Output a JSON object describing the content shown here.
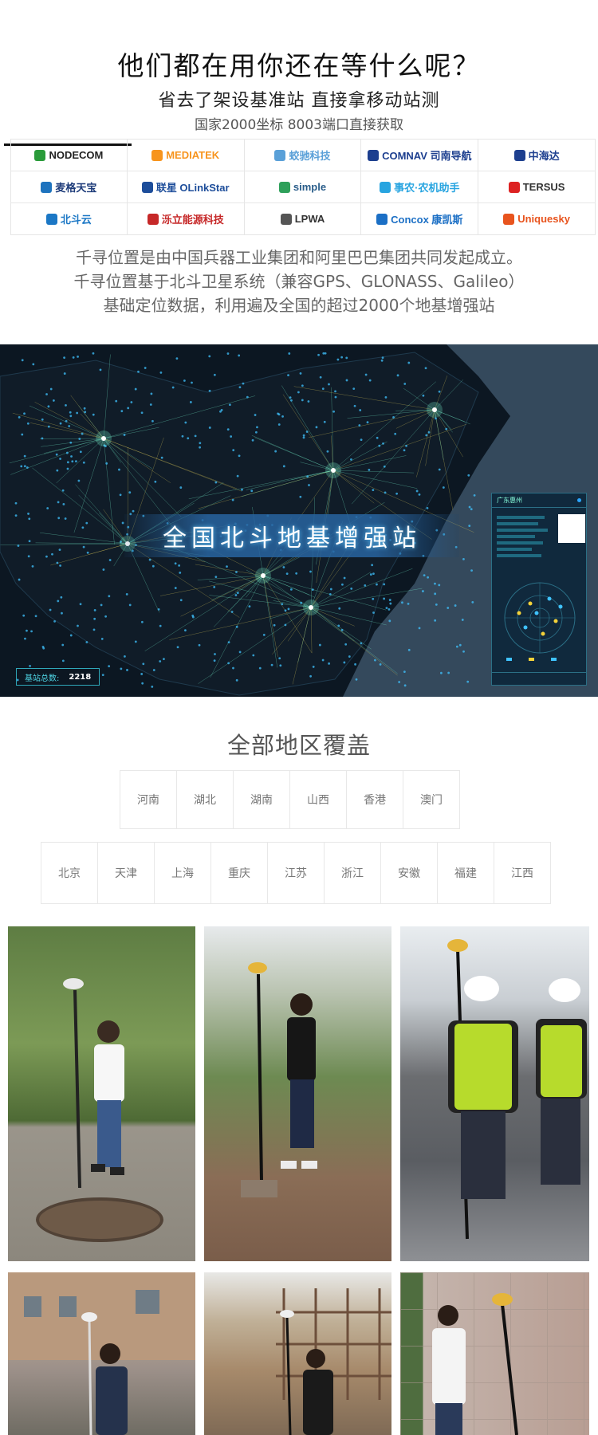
{
  "hero": {
    "title": "他们都在用你还在等什么呢？",
    "subtitle": "省去了架设基准站  直接拿移动站测",
    "note": "国家2000坐标  8003端口直接获取"
  },
  "partners": {
    "logos": [
      {
        "name": "NODECOM",
        "color": "#222222",
        "mark": "#2a9b3a"
      },
      {
        "name": "MEDIATEK",
        "color": "#f7941d",
        "mark": "#f7941d"
      },
      {
        "name": "蛟驰科技",
        "color": "#5aa0d8",
        "mark": "#5aa0d8"
      },
      {
        "name": "COMNAV 司南导航",
        "color": "#1d3f8f",
        "mark": "#1d3f8f"
      },
      {
        "name": "中海达",
        "color": "#1d3f8f",
        "mark": "#1d3f8f"
      },
      {
        "name": "麦格天宝",
        "color": "#1e3c7a",
        "mark": "#1e73be"
      },
      {
        "name": "联星 OLinkStar",
        "color": "#1d4d9a",
        "mark": "#1d4d9a"
      },
      {
        "name": "simple",
        "color": "#2a5d8a",
        "mark": "#2ea05a"
      },
      {
        "name": "事农·农机助手",
        "color": "#27a4e0",
        "mark": "#27a4e0"
      },
      {
        "name": "TERSUS",
        "color": "#333333",
        "mark": "#d22"
      },
      {
        "name": "北斗云",
        "color": "#1b77c5",
        "mark": "#1b77c5"
      },
      {
        "name": "泺立能源科技",
        "color": "#c62828",
        "mark": "#c62828"
      },
      {
        "name": "LPWA",
        "color": "#333333",
        "mark": "#555555"
      },
      {
        "name": "Concox 康凯斯",
        "color": "#1b6fc5",
        "mark": "#1b6fc5"
      },
      {
        "name": "Uniquesky",
        "color": "#e8541e",
        "mark": "#e8541e"
      }
    ]
  },
  "intro": {
    "line1": "千寻位置是由中国兵器工业集团和阿里巴巴集团共同发起成立。",
    "line2": "千寻位置基于北斗卫星系统（兼容GPS、GLONASS、Galileo）",
    "line3": "基础定位数据，利用遍及全国的超过2000个地基增强站"
  },
  "map": {
    "banner": "全国北斗地基增强站",
    "count_label": "基站总数:",
    "count_value": "2218",
    "panel_title": "广东惠州",
    "colors": {
      "node": "#3fc3ff",
      "hub": "#7affd6",
      "line": "#e8d25a"
    }
  },
  "coverage": {
    "title": "全部地区覆盖",
    "row1": [
      "河南",
      "湖北",
      "湖南",
      "山西",
      "香港",
      "澳门"
    ],
    "row2": [
      "北京",
      "天津",
      "上海",
      "重庆",
      "江苏",
      "浙江",
      "安徽",
      "福建",
      "江西"
    ]
  }
}
